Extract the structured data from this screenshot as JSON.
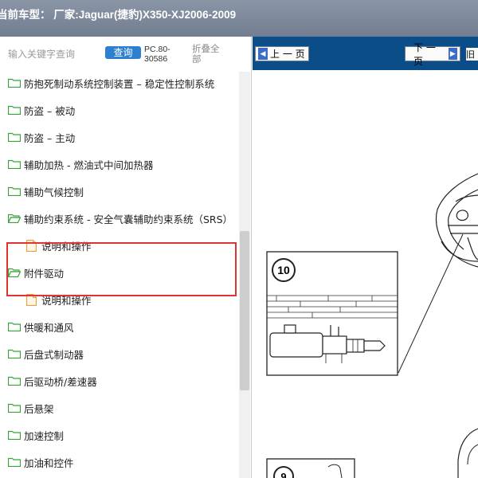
{
  "window": {
    "title": "当前车型： 厂家:Jaguar(捷豹)X350-XJ2006-2009"
  },
  "left_pane": {
    "search": {
      "placeholder": "输入关键字查询",
      "button_label": "查询",
      "code": "PC.80-30586",
      "collapse_label": "折叠全部"
    },
    "tree": [
      {
        "type": "folder",
        "label": "防抱死制动系统控制装置 – 稳定性控制系统"
      },
      {
        "type": "folder",
        "label": "防盗 – 被动"
      },
      {
        "type": "folder",
        "label": "防盗 – 主动"
      },
      {
        "type": "folder",
        "label": "辅助加热 - 燃油式中间加热器"
      },
      {
        "type": "folder",
        "label": "辅助气候控制"
      },
      {
        "type": "folder",
        "label": "辅助约束系统 - 安全气囊辅助约束系统（SRS）"
      },
      {
        "type": "doc",
        "label": "说明和操作"
      },
      {
        "type": "folder",
        "label": "附件驱动"
      },
      {
        "type": "doc",
        "label": "说明和操作"
      },
      {
        "type": "folder",
        "label": "供暖和通风"
      },
      {
        "type": "folder",
        "label": "后盘式制动器"
      },
      {
        "type": "folder",
        "label": "后驱动桥/差速器"
      },
      {
        "type": "folder",
        "label": "后悬架"
      },
      {
        "type": "folder",
        "label": "加速控制"
      },
      {
        "type": "folder",
        "label": "加油和控件"
      }
    ],
    "highlight_color": "#e03434"
  },
  "right_pane": {
    "nav": {
      "prev_label": "上 一 页",
      "next_label": "下 一 页",
      "cut_label": "旧"
    },
    "diagram": {
      "callouts": [
        "10",
        "9"
      ]
    },
    "nav_color": "#0b4d88"
  },
  "icons": {
    "folder": "folder-icon",
    "doc": "document-icon",
    "prev": "arrow-left-icon",
    "next": "arrow-right-icon"
  }
}
